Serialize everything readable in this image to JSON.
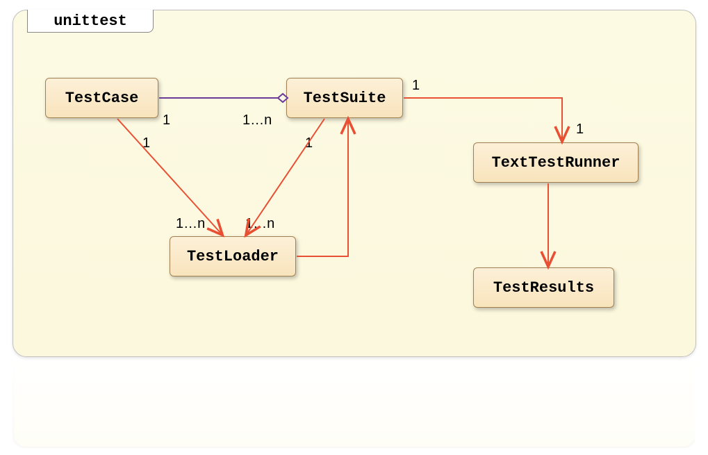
{
  "package": {
    "name": "unittest"
  },
  "classes": {
    "testcase": "TestCase",
    "testsuite": "TestSuite",
    "testloader": "TestLoader",
    "runner": "TextTestRunner",
    "results": "TestResults"
  },
  "multiplicities": {
    "tc_side": "1",
    "ts_side": "1…n",
    "tc_to_loader_top": "1",
    "ts_to_loader_top": "1",
    "loader_left": "1…n",
    "loader_right": "1…n",
    "ts_to_runner_source": "1",
    "ts_to_runner_target": "1"
  },
  "colors": {
    "arrow_red": "#e84f33",
    "arrow_purple": "#6a3a99"
  }
}
